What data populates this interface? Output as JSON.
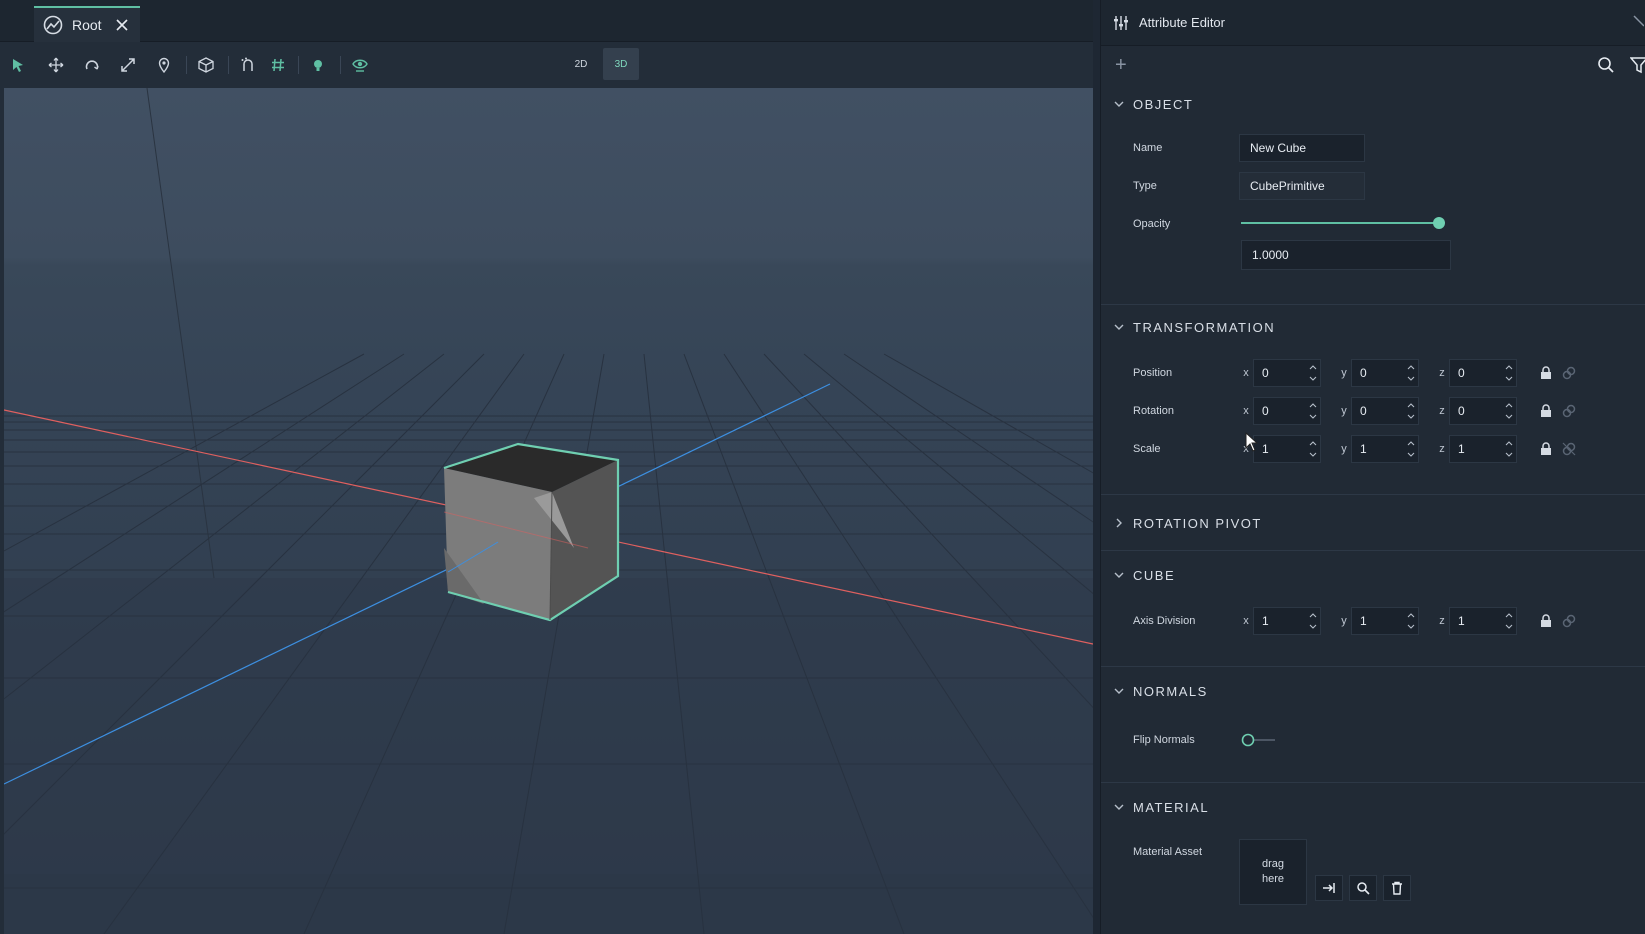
{
  "tab": {
    "label": "Root"
  },
  "toolbar": {
    "mode_2d": "2D",
    "mode_3d": "3D",
    "active_mode": "3D"
  },
  "editor": {
    "title": "Attribute Editor",
    "sections": {
      "object": {
        "title": "OBJECT",
        "name_label": "Name",
        "name_value": "New Cube",
        "type_label": "Type",
        "type_value": "CubePrimitive",
        "opacity_label": "Opacity",
        "opacity_value": "1.0000",
        "opacity_fraction": 1.0
      },
      "transformation": {
        "title": "TRANSFORMATION",
        "position_label": "Position",
        "position": {
          "x": "0",
          "y": "0",
          "z": "0"
        },
        "rotation_label": "Rotation",
        "rotation": {
          "x": "0",
          "y": "0",
          "z": "0"
        },
        "scale_label": "Scale",
        "scale": {
          "x": "1",
          "y": "1",
          "z": "1"
        }
      },
      "rotation_pivot": {
        "title": "ROTATION PIVOT"
      },
      "cube": {
        "title": "CUBE",
        "axis_division_label": "Axis Division",
        "axis_division": {
          "x": "1",
          "y": "1",
          "z": "1"
        }
      },
      "normals": {
        "title": "NORMALS",
        "flip_label": "Flip Normals",
        "flip_on": false
      },
      "material": {
        "title": "MATERIAL",
        "asset_label": "Material Asset",
        "drag_line1": "drag",
        "drag_line2": "here"
      }
    },
    "axis_labels": {
      "x": "x",
      "y": "y",
      "z": "z"
    }
  },
  "colors": {
    "accent": "#5fbfa3",
    "x_axis": "#e0605f",
    "z_axis": "#3d8fe0",
    "panel": "#212a35"
  }
}
